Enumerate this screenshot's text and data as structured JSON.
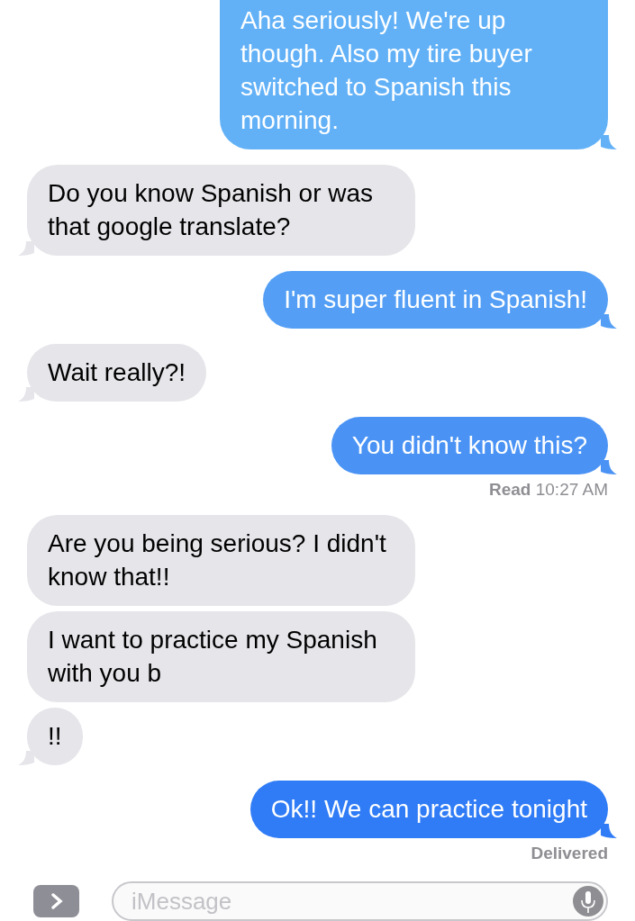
{
  "messages": [
    {
      "kind": "sent",
      "text": "Aha seriously! We're up though. Also my tire buyer switched to Spanish this morning.",
      "color": "#62b1f7",
      "tail": true
    },
    {
      "kind": "received",
      "text": "Do you know Spanish or was that google translate?",
      "tail": true
    },
    {
      "kind": "sent",
      "text": "I'm super fluent in Spanish!",
      "color": "#549ff5",
      "tail": true
    },
    {
      "kind": "received",
      "text": "Wait really?!",
      "tail": true
    },
    {
      "kind": "sent",
      "text": "You didn't know this?",
      "color": "#4a93f5",
      "tail": true
    },
    {
      "kind": "status",
      "text": "**Read** 10:27 AM"
    },
    {
      "kind": "received",
      "text": "Are you being serious? I didn't know that!!",
      "tail": false
    },
    {
      "kind": "received",
      "text": "I want to practice my Spanish with you b",
      "tail": false
    },
    {
      "kind": "received",
      "text": "!!",
      "tail": true
    },
    {
      "kind": "sent",
      "text": "Ok!! We can practice tonight",
      "color": "#2f7cf6",
      "tail": true
    },
    {
      "kind": "status",
      "text": "Delivered"
    }
  ],
  "composer": {
    "placeholder": "iMessage"
  }
}
